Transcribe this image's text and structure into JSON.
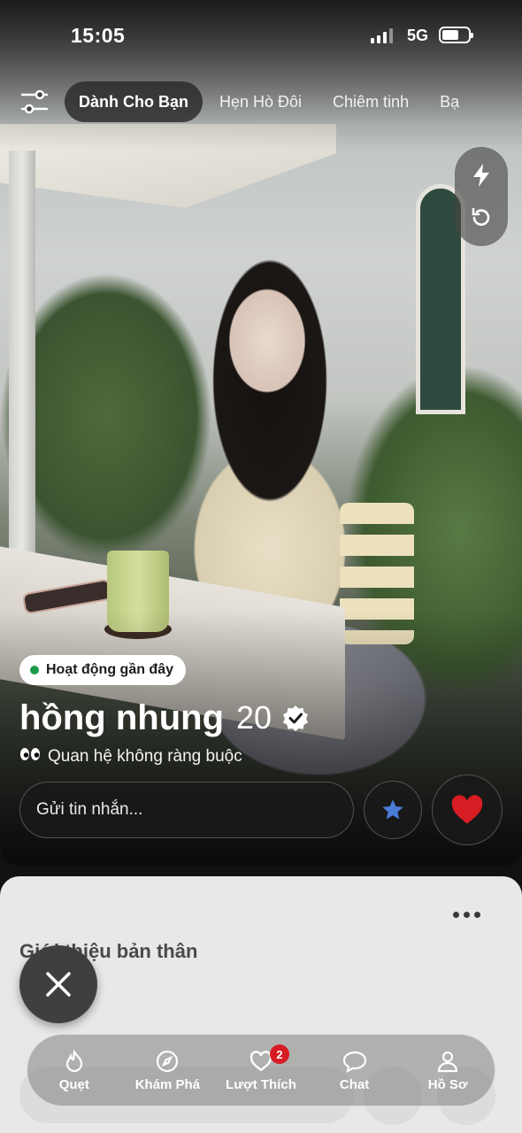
{
  "status_bar": {
    "time": "15:05",
    "network": "5G"
  },
  "tabs": [
    {
      "label": "Dành Cho Bạn",
      "active": true
    },
    {
      "label": "Hẹn Hò Đôi",
      "active": false
    },
    {
      "label": "Chiêm tinh",
      "active": false
    },
    {
      "label": "Bạ",
      "active": false
    }
  ],
  "side_actions": {
    "boost_icon": "lightning-icon",
    "rewind_icon": "rewind-icon"
  },
  "profile": {
    "activity_status": "Hoạt động gần đây",
    "name": "hồng nhung",
    "age": "20",
    "relationship_goal": "Quan hệ không ràng buộc",
    "verified": true
  },
  "message": {
    "placeholder": "Gửi tin nhắn..."
  },
  "sheet": {
    "section_title": "Giới thiệu bản thân"
  },
  "bottom_nav": [
    {
      "label": "Quẹt",
      "icon": "flame-icon"
    },
    {
      "label": "Khám Phá",
      "icon": "compass-icon"
    },
    {
      "label": "Lượt Thích",
      "icon": "heart-icon",
      "badge": "2"
    },
    {
      "label": "Chat",
      "icon": "chat-bubble-icon"
    },
    {
      "label": "Hồ Sơ",
      "icon": "profile-icon"
    }
  ],
  "colors": {
    "like_red": "#d81c23",
    "star_blue": "#4a7bd5",
    "online_green": "#1e9a4a"
  }
}
